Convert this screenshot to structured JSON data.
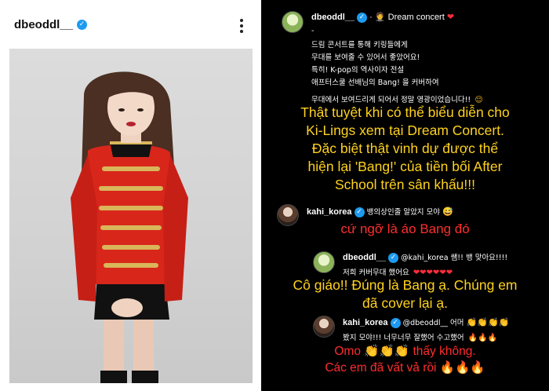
{
  "post": {
    "username": "dbeoddl__",
    "verified_glyph": "✓",
    "more_options_icon": "more-options-icon"
  },
  "caption": {
    "username": "dbeoddl__",
    "title_text": "Dream concert",
    "dash": "-",
    "korean_lines": [
      "드림 콘서트를 통해 키링들에게",
      "무대를 보여줄 수 있어서 좋았어요!",
      "특히! K-pop의 역사이자 전설",
      "애프터스쿨 선배님의 Bang! 을 커버하여",
      "무대에서 보여드리게 되어서 정말 영광이었습니다!!"
    ],
    "translation_lines": [
      "Thật tuyệt khi có thể biểu diễn cho",
      "Ki-Lings xem tại Dream Concert.",
      "Đặc biệt thật vinh dự được thể",
      "hiện lại 'Bang!' của tiền bối After",
      "School trên sân khấu!!!"
    ]
  },
  "comment1": {
    "username": "kahi_korea",
    "text": "뱅의상인줄 알았지 모야",
    "translation": "cứ ngỡ là áo Bang đó"
  },
  "reply1": {
    "username": "dbeoddl__",
    "mention": "@kahi_korea 쌤!! 뱅 맞아요!!!!",
    "line2": "저희 커버무대 했어요",
    "translation_lines": [
      "Cô giáo!! Đúng là Bang ạ. Chúng em",
      "đã cover lại ạ."
    ]
  },
  "reply2": {
    "username": "kahi_korea",
    "mention": "@dbeoddl__ 어머",
    "line2": "봤지 모야!!! 너무너무 잘했어 수고했어",
    "translation_lines": [
      "Omo",
      "thấy không.",
      "Các em đã vất vả rồi"
    ]
  },
  "colors": {
    "translation_yellow": "#ffd21f",
    "translation_red": "#ff2d2d",
    "verified_blue": "#1d9bf0",
    "heart_red": "#ff2d3a"
  }
}
